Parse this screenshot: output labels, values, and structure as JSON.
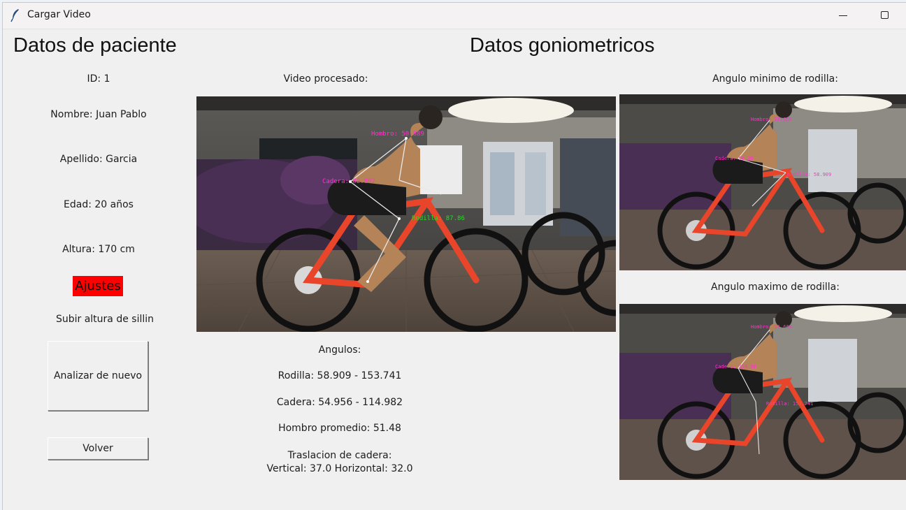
{
  "window": {
    "title": "Cargar Video"
  },
  "left": {
    "heading": "Datos de paciente",
    "id": "ID: 1",
    "nombre": "Nombre: Juan Pablo",
    "apellido": "Apellido: Garcia",
    "edad": "Edad: 20 años",
    "altura": "Altura: 170 cm",
    "ajustes": "Ajustes",
    "advice": "Subir altura de sillin",
    "analizar_button": "Analizar de nuevo",
    "volver_button": "Volver"
  },
  "center": {
    "heading": "Datos goniometricos",
    "video_label": "Video procesado:",
    "angulos_label": "Angulos:",
    "rodilla": "Rodilla: 58.909 - 153.741",
    "cadera": "Cadera: 54.956 - 114.982",
    "hombro": "Hombro promedio: 51.48",
    "traslacion_label": "Traslacion de cadera:",
    "traslacion_values": "Vertical: 37.0  Horizontal:   32.0"
  },
  "right": {
    "min_label": "Angulo minimo de rodilla:",
    "max_label": "Angulo maximo de rodilla:"
  },
  "overlays": {
    "main": {
      "hombro": "Hombro: 50.889",
      "cadera": "Cadera: 82.892",
      "rodilla": "Rodilla: 87.86"
    },
    "min": {
      "hombro": "Hombro: 53.955",
      "cadera": "Cadera: 58.26",
      "rodilla": "Rodilla: 58.909"
    },
    "max": {
      "hombro": "Hombro: 51.664",
      "cadera": "Cadera: 114.98",
      "rodilla": "Rodilla: 153.741"
    }
  },
  "colors": {
    "ajustes_bg": "#ff0000",
    "overlay_magenta": "#ff33cc",
    "overlay_green": "#22dd22",
    "bike_frame": "#e8452a"
  }
}
